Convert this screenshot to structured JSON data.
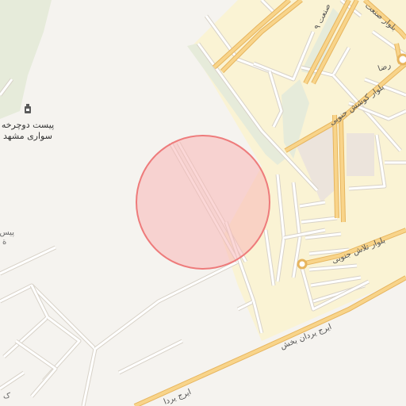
{
  "map": {
    "colors": {
      "background": "#f5f3ef",
      "urban": "#faf3d4",
      "greenery": "#e6ebda",
      "block": "#ece4dc",
      "major_road": "#f8d48a",
      "major_road_casing": "#e7b55e",
      "minor_road": "#ffffff",
      "minor_road_casing": "#d8d2c8",
      "marker_fill": "#f7b7b7",
      "marker_stroke": "#ee7b7b"
    },
    "marker": {
      "type": "circle",
      "opacity": 0.55
    },
    "labels": {
      "poi_name_line1": "پیست دوچرخه",
      "poi_name_line2": "سواری مشهد",
      "left_partial": "پیس",
      "left_partial2": "ة",
      "bottom_left_partial": "ک",
      "street_golshan": "بلوار کوشش جنوبی",
      "street_talash": "بلوار تلاش جنوبی",
      "street_iraj": "ایرج یردان بخش",
      "street_iraj2": "ایرج یردا",
      "street_sanat": "بلوار صنعت",
      "street_reza": "رضا",
      "street_sanat9": "صنعت ۹"
    },
    "icons": [
      "bicycle-track-icon"
    ]
  }
}
